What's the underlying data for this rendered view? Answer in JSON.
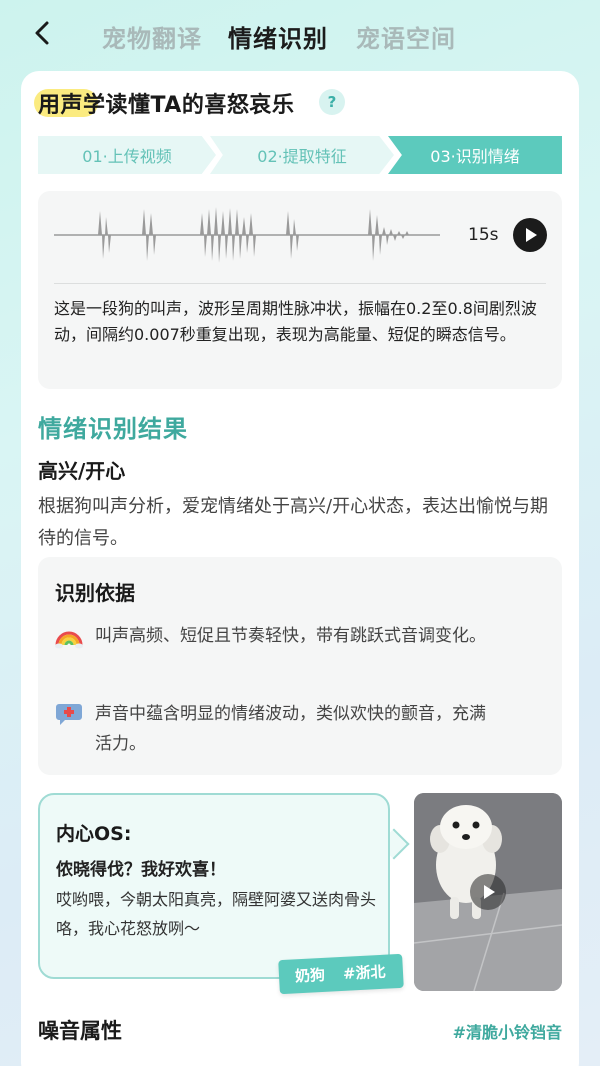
{
  "nav": {
    "tabs": [
      {
        "label": "宠物翻译",
        "active": false
      },
      {
        "label": "情绪识别",
        "active": true
      },
      {
        "label": "宠语空间",
        "active": false
      }
    ]
  },
  "headline": "用声学读懂TA的喜怒哀乐",
  "help_symbol": "?",
  "steps": [
    "01·上传视频",
    "02·提取特征",
    "03·识别情绪"
  ],
  "audio": {
    "duration": "15s",
    "description": "这是一段狗的叫声，波形呈周期性脉冲状，振幅在0.2至0.8间剧烈波动，间隔约0.007秒重复出现，表现为高能量、短促的瞬态信号。"
  },
  "result": {
    "title": "情绪识别结果",
    "emotion": "高兴/开心",
    "description": "根据狗叫声分析，爱宠情绪处于高兴/开心状态，表达出愉悦与期待的信号。"
  },
  "basis": {
    "title": "识别依据",
    "items": [
      {
        "icon": "rainbow-icon",
        "text": "叫声高频、短促且节奏轻快，带有跳跃式音调变化。"
      },
      {
        "icon": "speech-bubble-plus-icon",
        "text": "声音中蕴含明显的情绪波动，类似欢快的颤音，充满活力。"
      }
    ]
  },
  "inner_os": {
    "title": "内心OS:",
    "subtitle": "侬晓得伐？我好欢喜！",
    "text": "哎哟喂，今朝太阳真亮，隔壁阿婆又送肉骨头咯，我心花怒放咧～",
    "tags": [
      "奶狗",
      "#浙北"
    ]
  },
  "noise": {
    "title": "噪音属性",
    "tag": "#清脆小铃铛音"
  },
  "colors": {
    "accent": "#5ccabd",
    "accent_text": "#3fa99e",
    "step_inactive_bg": "#e6f7f5",
    "panel_bg": "#f5f6f6"
  }
}
